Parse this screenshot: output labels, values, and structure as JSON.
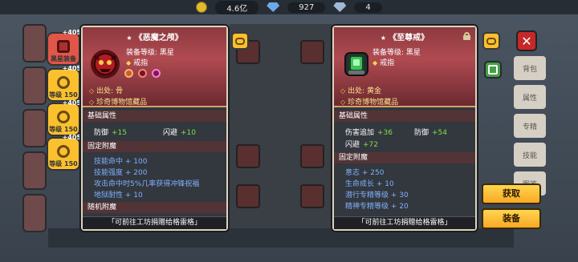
{
  "topbar": {
    "coins": "4.6亿",
    "gems": "927",
    "tickets": "4"
  },
  "sidebar": {
    "items": [
      {
        "plus": "+405",
        "label": "黑星装备",
        "active": true
      },
      {
        "plus": "+405",
        "label": "等级 150",
        "active": false
      },
      {
        "plus": "+405",
        "label": "等级 150",
        "active": false
      },
      {
        "plus": "+405",
        "label": "等级 150",
        "active": false
      }
    ]
  },
  "left_panel": {
    "title": "《恶魔之颅》",
    "level_label": "装备等级: 黑星",
    "slot_label": "戒指",
    "origin_label": "出处: 骨",
    "museum_label": "珍奇博物馆藏品",
    "base_header": "基础属性",
    "base_stats": [
      {
        "name": "防御",
        "value": "+15"
      },
      {
        "name": "闪避",
        "value": "+10"
      }
    ],
    "fixed_header": "固定附魔",
    "fixed_lines": [
      "技能命中 + 100",
      "技能强度 + 200",
      "攻击命中时5%几率获得冲锋祝福",
      "地狱耐性 + 10"
    ],
    "random_header": "随机附魔",
    "footer": "「可前往工坊捐赠给格雷格」"
  },
  "right_panel": {
    "title": "《至尊戒》",
    "level_label": "装备等级: 黑星",
    "slot_label": "戒指",
    "origin_label": "出处: 黄金",
    "museum_label": "珍奇博物馆藏品",
    "base_header": "基础属性",
    "base_stats": [
      {
        "name": "伤害追加",
        "value": "+36"
      },
      {
        "name": "防御",
        "value": "+54"
      },
      {
        "name": "闪避",
        "value": "+72"
      }
    ],
    "fixed_header": "固定附魔",
    "fixed_lines": [
      "意志 + 250",
      "生命成长 + 10",
      "潜行专精等级 + 30",
      "精神专精等级 + 20"
    ],
    "footer": "「可前往工坊捐赠给格雷格」"
  },
  "actions": {
    "take": "获取",
    "equip": "装备"
  },
  "right_tabs": [
    "背包",
    "属性",
    "专精",
    "技能",
    "图鉴"
  ],
  "colors": {
    "accent_yellow": "#fbc02d",
    "stat_green": "#7ce04a",
    "enchant_blue": "#7fb2ff",
    "header_red": "#b04a51"
  }
}
